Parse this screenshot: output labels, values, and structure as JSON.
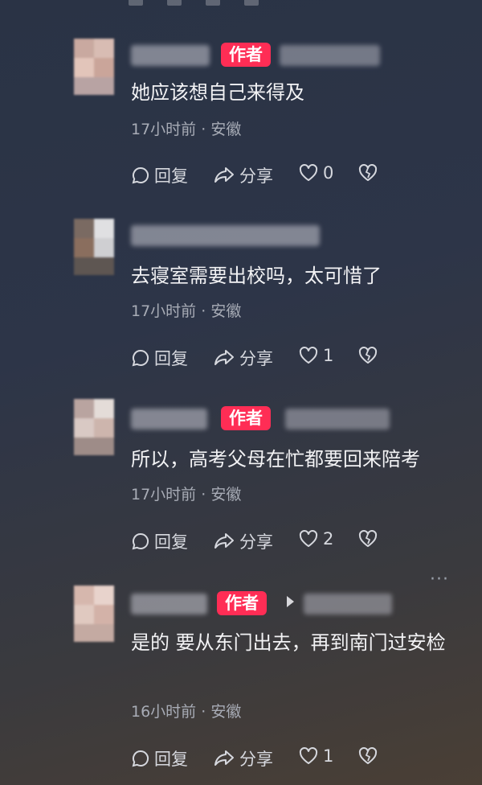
{
  "author_badge": "作者",
  "actions": {
    "reply": "回复",
    "share": "分享"
  },
  "comments": [
    {
      "text": "她应该想自己来得及",
      "time": "17小时前",
      "location": "安徽",
      "likes": "0",
      "is_author": true
    },
    {
      "text": "去寝室需要出校吗，太可惜了",
      "time": "17小时前",
      "location": "安徽",
      "likes": "1",
      "is_author": false
    },
    {
      "text": "所以，高考父母在忙都要回来陪考",
      "time": "17小时前",
      "location": "安徽",
      "likes": "2",
      "is_author": true
    },
    {
      "text": "是的 要从东门出去，再到南门过安检",
      "time": "16小时前",
      "location": "安徽",
      "likes": "1",
      "is_author": true
    }
  ],
  "separator": "·",
  "more_icon": "···",
  "colors": {
    "badge": "#ff2d55",
    "meta": "#a8acb6"
  }
}
